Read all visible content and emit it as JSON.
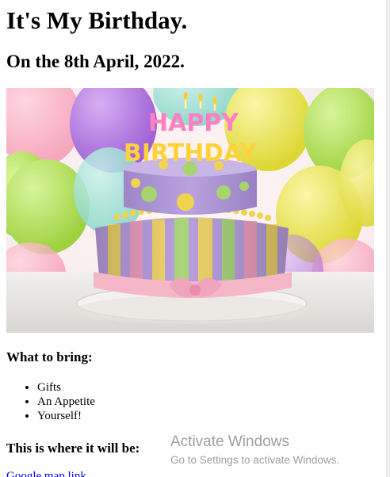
{
  "page": {
    "title": "It's My Birthday.",
    "date_line": "On the 8th April, 2022."
  },
  "image": {
    "description_icon": "birthday-cake-image",
    "topper_line1": "HAPPY",
    "topper_line2": "BIRTHDAY"
  },
  "bring": {
    "heading": "What to bring:",
    "items": [
      "Gifts",
      "An Appetite",
      "Yourself!"
    ]
  },
  "location": {
    "heading": "This is where it will be:",
    "link_text": "Google map link"
  },
  "watermark": {
    "title": "Activate Windows",
    "subtitle": "Go to Settings to activate Windows."
  },
  "colors": {
    "link": "#0000ee",
    "watermark": "#787878"
  }
}
